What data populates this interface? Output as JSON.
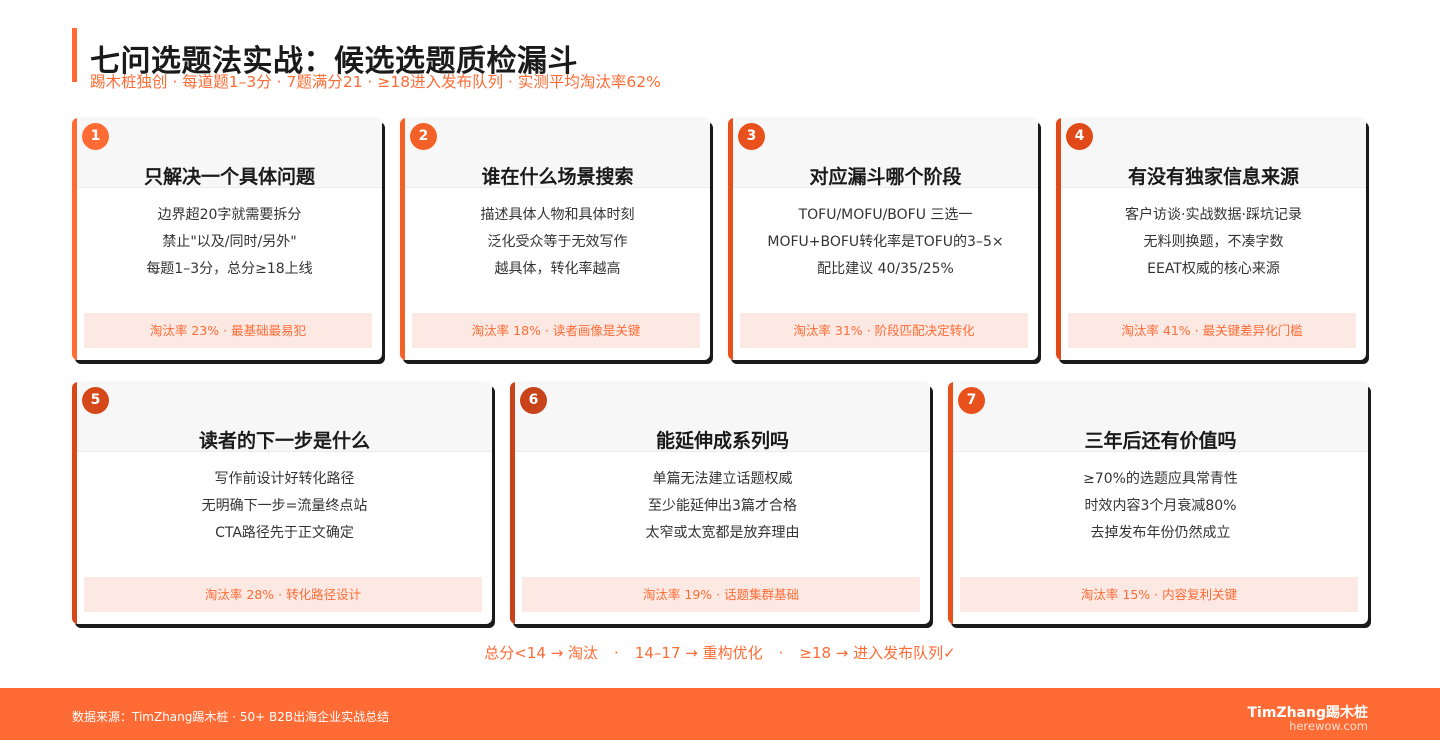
{
  "header": {
    "title": "七问选题法实战：候选选题质检漏斗",
    "subtitle": "踢木桩独创 · 每道题1–3分 · 7题满分21 · ≥18进入发布队列 · 实测平均淘汰率62%"
  },
  "colors": {
    "accent": "#ff6b35",
    "dark_accent": "#e8501c",
    "footer_bg": "#ff6b35",
    "footer_tint": "#fde9e3"
  },
  "cards": [
    {
      "num": "1",
      "title": "只解决一个具体问题",
      "lines": [
        "边界超20字就需要拆分",
        "禁止\"以及/同时/另外\"",
        "每题1–3分，总分≥18上线"
      ],
      "footer": "淘汰率 23% · 最基础最易犯"
    },
    {
      "num": "2",
      "title": "谁在什么场景搜索",
      "lines": [
        "描述具体人物和具体时刻",
        "泛化受众等于无效写作",
        "越具体，转化率越高"
      ],
      "footer": "淘汰率 18% · 读者画像是关键"
    },
    {
      "num": "3",
      "title": "对应漏斗哪个阶段",
      "lines": [
        "TOFU/MOFU/BOFU 三选一",
        "MOFU+BOFU转化率是TOFU的3–5×",
        "配比建议 40/35/25%"
      ],
      "footer": "淘汰率 31% · 阶段匹配决定转化"
    },
    {
      "num": "4",
      "title": "有没有独家信息来源",
      "lines": [
        "客户访谈·实战数据·踩坑记录",
        "无料则换题，不凑字数",
        "EEAT权威的核心来源"
      ],
      "footer": "淘汰率 41% · 最关键差异化门槛"
    },
    {
      "num": "5",
      "title": "读者的下一步是什么",
      "lines": [
        "写作前设计好转化路径",
        "无明确下一步=流量终点站",
        "CTA路径先于正文确定"
      ],
      "footer": "淘汰率 28% · 转化路径设计"
    },
    {
      "num": "6",
      "title": "能延伸成系列吗",
      "lines": [
        "单篇无法建立话题权威",
        "至少能延伸出3篇才合格",
        "太窄或太宽都是放弃理由"
      ],
      "footer": "淘汰率 19% · 话题集群基础"
    },
    {
      "num": "7",
      "title": "三年后还有价值吗",
      "lines": [
        "≥70%的选题应具常青性",
        "时效内容3个月衰减80%",
        "去掉发布年份仍然成立"
      ],
      "footer": "淘汰率 15% · 内容复利关键"
    }
  ],
  "rule": {
    "part1": "总分<14 → 淘汰",
    "sep1": "·",
    "part2": "14–17 → 重构优化",
    "sep2": "·",
    "part3": "≥18 → 进入发布队列✓"
  },
  "footer": {
    "source": "数据来源：TimZhang踢木桩 · 50+ B2B出海企业实战总结",
    "brand": "TimZhang踢木桩",
    "site": "herewow.com"
  }
}
